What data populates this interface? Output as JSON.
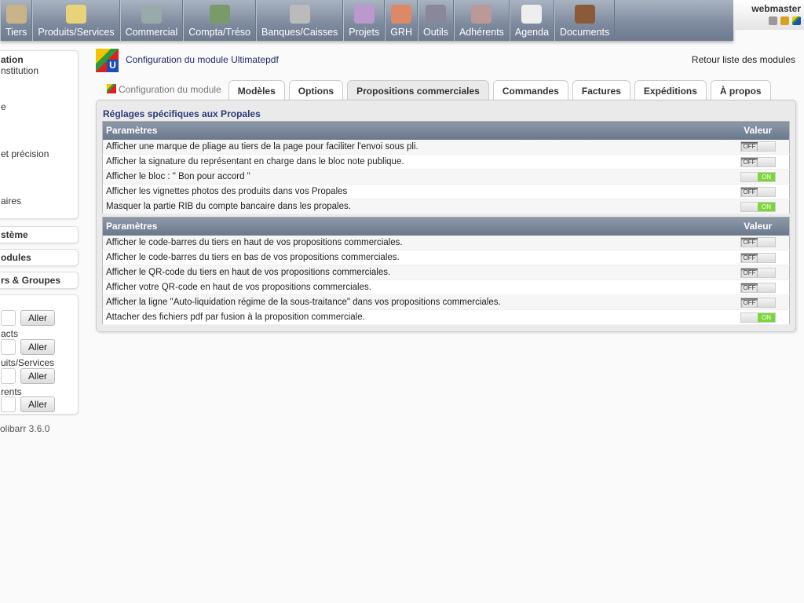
{
  "menu": [
    "Tiers",
    "Produits/Services",
    "Commercial",
    "Compta/Tréso",
    "Banques/Caisses",
    "Projets",
    "GRH",
    "Outils",
    "Adhérents",
    "Agenda",
    "Documents"
  ],
  "user": {
    "name": "webmaster",
    "icons": [
      "printer-icon",
      "lock-icon",
      "ultimatepdf-icon"
    ]
  },
  "sidebar": {
    "setup_title": "ation",
    "setup_items": [
      "nstitution",
      "e",
      "et précision",
      "aires"
    ],
    "system": "stème",
    "modules": "odules",
    "users": "rs & Groupes",
    "search": [
      {
        "label": "",
        "button": "Aller"
      },
      {
        "label": "acts",
        "button": "Aller"
      },
      {
        "label": "uits/Services",
        "button": "Aller"
      },
      {
        "label": "rents",
        "button": "Aller"
      }
    ],
    "version": "olibarr 3.6.0"
  },
  "header": {
    "title": "Configuration du module Ultimatepdf",
    "back_link": "Retour liste des modules"
  },
  "tabs": [
    {
      "label": "Configuration du module"
    },
    {
      "label": "Modèles"
    },
    {
      "label": "Options"
    },
    {
      "label": "Propositions commerciales",
      "active": true
    },
    {
      "label": "Commandes"
    },
    {
      "label": "Factures"
    },
    {
      "label": "Expéditions"
    },
    {
      "label": "À propos"
    }
  ],
  "section_title": "Réglages spécifiques aux Propales",
  "tables": [
    {
      "col1": "Paramètres",
      "col2": "Valeur",
      "rows": [
        {
          "label": "Afficher une marque de pliage au tiers de la page pour faciliter l'envoi sous pli.",
          "value": "OFF"
        },
        {
          "label": "Afficher la signature du représentant en charge dans le bloc note publique.",
          "value": "OFF"
        },
        {
          "label": "Afficher le bloc : \" Bon pour accord \"",
          "value": "ON"
        },
        {
          "label": "Afficher les vignettes photos des produits dans vos Propales",
          "value": "OFF"
        },
        {
          "label": "Masquer la partie RIB du compte bancaire dans les propales.",
          "value": "ON"
        }
      ]
    },
    {
      "col1": "Paramètres",
      "col2": "Valeur",
      "rows": [
        {
          "label": "Afficher le code-barres du tiers en haut de vos propositions commerciales.",
          "value": "OFF"
        },
        {
          "label": "Afficher le code-barres du tiers en bas de vos propositions commerciales.",
          "value": "OFF"
        },
        {
          "label": "Afficher le QR-code du tiers en haut de vos propositions commerciales.",
          "value": "OFF"
        },
        {
          "label": "Afficher votre QR-code en haut de vos propositions commerciales.",
          "value": "OFF"
        },
        {
          "label": "Afficher la ligne \"Auto-liquidation régime de la sous-traitance\" dans vos propositions commerciales.",
          "value": "OFF"
        },
        {
          "label": "Attacher des fichiers pdf par fusion à la proposition commerciale.",
          "value": "ON"
        }
      ]
    }
  ],
  "colors": {
    "menu": "#7d8a9d",
    "on": "#7cd63a",
    "title": "#1e2a6e"
  }
}
